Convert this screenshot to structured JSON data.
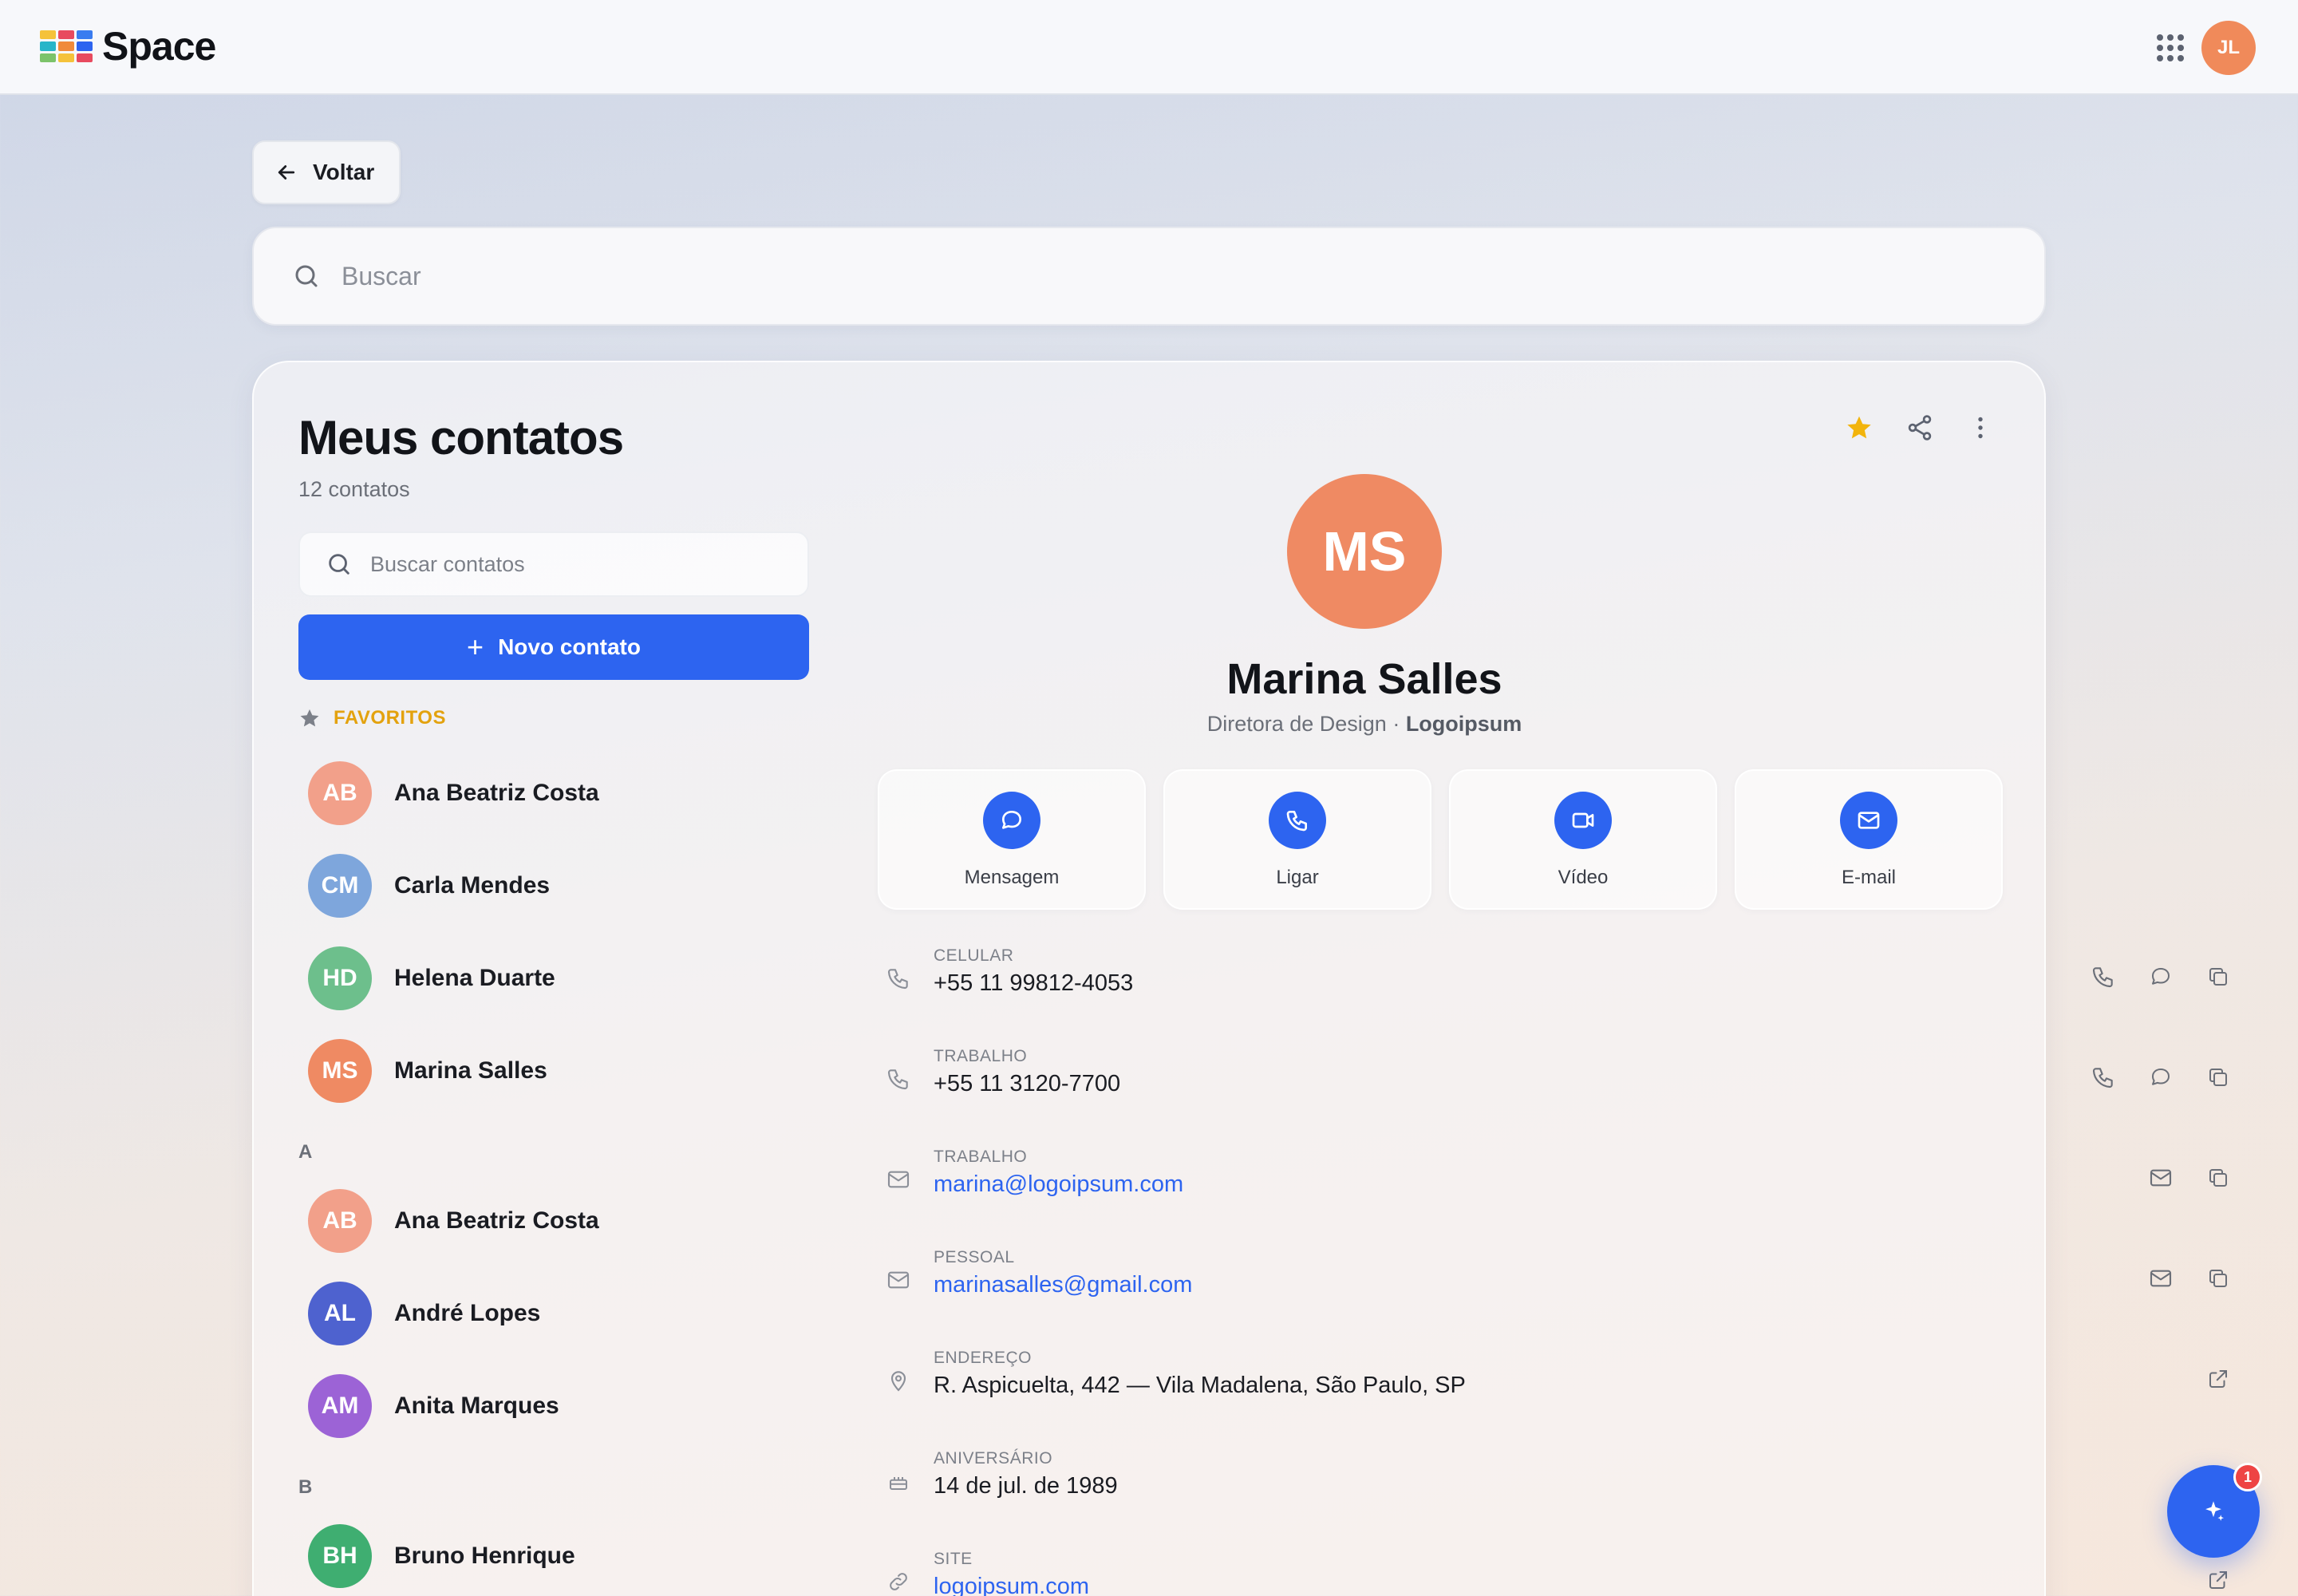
{
  "app": {
    "name": "Space",
    "user_initials": "JL",
    "user_color": "#f08a5a"
  },
  "nav": {
    "back_label": "Voltar"
  },
  "search": {
    "placeholder": "Buscar"
  },
  "contacts": {
    "title": "Meus contatos",
    "count_label": "12 contatos",
    "search_placeholder": "Buscar contatos",
    "new_contact_label": "Novo contato",
    "favorites_label": "FAVORITOS",
    "favorites": [
      {
        "initials": "AB",
        "name": "Ana Beatriz Costa",
        "color": "#f2a08a"
      },
      {
        "initials": "CM",
        "name": "Carla Mendes",
        "color": "#7ea6dc"
      },
      {
        "initials": "HD",
        "name": "Helena Duarte",
        "color": "#6dbf8c"
      },
      {
        "initials": "MS",
        "name": "Marina Salles",
        "color": "#ef8a63"
      }
    ],
    "sections": [
      {
        "letter": "A",
        "items": [
          {
            "initials": "AB",
            "name": "Ana Beatriz Costa",
            "color": "#f2a08a"
          },
          {
            "initials": "AL",
            "name": "André Lopes",
            "color": "#4e62cf"
          },
          {
            "initials": "AM",
            "name": "Anita Marques",
            "color": "#9c63d6"
          }
        ]
      },
      {
        "letter": "B",
        "items": [
          {
            "initials": "BH",
            "name": "Bruno Henrique",
            "color": "#3fae71"
          }
        ]
      }
    ]
  },
  "detail": {
    "initials": "MS",
    "name": "Marina Salles",
    "role": "Diretora de Design · ",
    "company": "Logoipsum",
    "favorite_color": "#f2b40c",
    "actions": [
      {
        "label": "Mensagem",
        "icon": "message-icon"
      },
      {
        "label": "Ligar",
        "icon": "phone-icon"
      },
      {
        "label": "Vídeo",
        "icon": "video-icon"
      },
      {
        "label": "E-mail",
        "icon": "mail-icon"
      }
    ],
    "fields": [
      {
        "label": "CELULAR",
        "value": "+55 11 99812-4053",
        "icon": "phone-icon"
      },
      {
        "label": "TRABALHO",
        "value": "+55 11 3120-7700",
        "icon": "phone-icon"
      },
      {
        "label": "TRABALHO",
        "value": "marina@logoipsum.com",
        "icon": "mail-icon"
      },
      {
        "label": "PESSOAL",
        "value": "marinasalles@gmail.com",
        "icon": "mail-icon"
      },
      {
        "label": "ENDEREÇO",
        "value": "R. Aspicuelta, 442 — Vila Madalena, São Paulo, SP",
        "icon": "location-icon"
      },
      {
        "label": "ANIVERSÁRIO",
        "value": "14 de jul. de 1989",
        "icon": "cake-icon"
      },
      {
        "label": "SITE",
        "value": "logoipsum.com",
        "icon": "link-icon"
      }
    ]
  },
  "assistant": {
    "badge_count": "1"
  },
  "colors": {
    "accent": "#2d64f0",
    "favorite": "#e3a20e"
  }
}
